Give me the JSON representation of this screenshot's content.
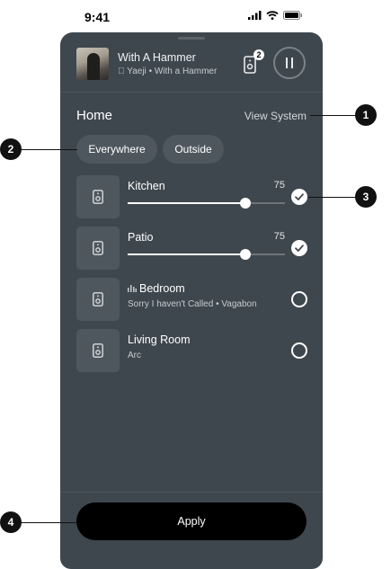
{
  "status_bar": {
    "time": "9:41"
  },
  "now_playing": {
    "title": "With A Hammer",
    "artist": "Yaeji",
    "album": "With a Hammer",
    "speaker_count": "2",
    "apple_glyph": ""
  },
  "section": {
    "title": "Home",
    "view_system_label": "View System"
  },
  "chips": [
    {
      "label": "Everywhere"
    },
    {
      "label": "Outside"
    }
  ],
  "rooms": [
    {
      "name": "Kitchen",
      "volume": "75",
      "volume_level": 0.75,
      "selected": true
    },
    {
      "name": "Patio",
      "volume": "75",
      "volume_level": 0.75,
      "selected": true
    },
    {
      "name": "Bedroom",
      "subtitle": "Sorry I haven't Called • Vagabon",
      "selected": false,
      "playing": true
    },
    {
      "name": "Living Room",
      "subtitle": "Arc",
      "selected": false
    }
  ],
  "apply_label": "Apply",
  "callouts": [
    "1",
    "2",
    "3",
    "4"
  ],
  "colors": {
    "sheet_bg": "#3f474e",
    "tile_bg": "#4f575e",
    "button_bg": "#000000"
  },
  "icons": [
    "signal-icon",
    "wifi-icon",
    "battery-icon",
    "speaker-icon",
    "pause-icon",
    "check-icon",
    "playing-bars-icon"
  ]
}
